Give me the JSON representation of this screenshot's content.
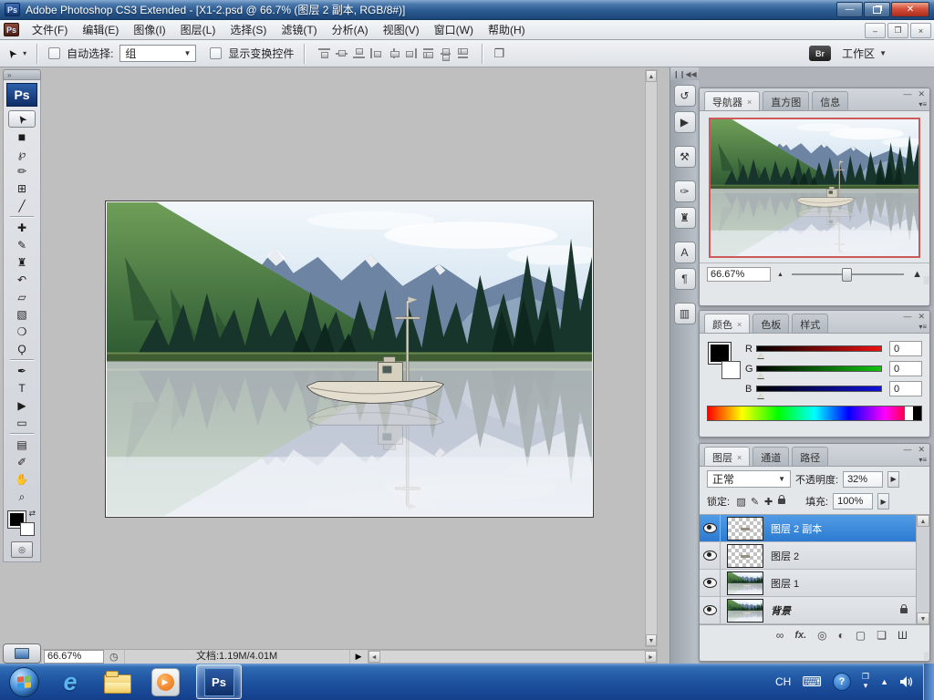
{
  "app": {
    "icon_text": "Ps",
    "bridge_badge": "Br"
  },
  "window": {
    "title": "Adobe Photoshop CS3 Extended - [X1-2.psd @ 66.7% (图层 2 副本, RGB/8#)]",
    "minimize_glyph": "—",
    "close_glyph": "✕"
  },
  "menu_bar": {
    "items": [
      {
        "key": "file",
        "label": "文件(F)"
      },
      {
        "key": "edit",
        "label": "编辑(E)"
      },
      {
        "key": "image",
        "label": "图像(I)"
      },
      {
        "key": "layer",
        "label": "图层(L)"
      },
      {
        "key": "select",
        "label": "选择(S)"
      },
      {
        "key": "filter",
        "label": "滤镜(T)"
      },
      {
        "key": "analysis",
        "label": "分析(A)"
      },
      {
        "key": "view",
        "label": "视图(V)"
      },
      {
        "key": "window",
        "label": "窗口(W)"
      },
      {
        "key": "help",
        "label": "帮助(H)"
      }
    ]
  },
  "options_bar": {
    "move_tool_glyph": "➤",
    "auto_select_label": "自动选择:",
    "auto_select_value": "组",
    "show_transform_label": "显示变换控件",
    "workspace_label": "工作区",
    "align_icons": [
      {
        "name": "align-top-edges-icon",
        "cls": "at"
      },
      {
        "name": "align-vertical-centers-icon",
        "cls": "am"
      },
      {
        "name": "align-bottom-edges-icon",
        "cls": "ab"
      },
      {
        "name": "align-left-edges-icon",
        "cls": "al"
      },
      {
        "name": "align-horizontal-centers-icon",
        "cls": "ac"
      },
      {
        "name": "align-right-edges-icon",
        "cls": "ar"
      },
      {
        "name": "distribute-top-edges-icon",
        "cls": "dt"
      },
      {
        "name": "distribute-vertical-centers-icon",
        "cls": "dc"
      },
      {
        "name": "distribute-bottom-edges-icon",
        "cls": "db"
      }
    ],
    "auto_align_glyph": "❒"
  },
  "toolbox": {
    "expand_glyph": "»",
    "tools": [
      {
        "name": "move-tool",
        "glyph": "➤",
        "selected": true
      },
      {
        "name": "rectangular-marquee-tool",
        "glyph": "■"
      },
      {
        "name": "lasso-tool",
        "glyph": "℘"
      },
      {
        "name": "quick-selection-tool",
        "glyph": "✏"
      },
      {
        "name": "crop-tool",
        "glyph": "⊞"
      },
      {
        "name": "slice-tool",
        "glyph": "╱"
      },
      {
        "name": "spot-healing-brush-tool",
        "glyph": "✚",
        "sep": true
      },
      {
        "name": "brush-tool",
        "glyph": "✎"
      },
      {
        "name": "clone-stamp-tool",
        "glyph": "♜"
      },
      {
        "name": "history-brush-tool",
        "glyph": "↶"
      },
      {
        "name": "eraser-tool",
        "glyph": "▱"
      },
      {
        "name": "gradient-tool",
        "glyph": "▧"
      },
      {
        "name": "blur-tool",
        "glyph": "❍"
      },
      {
        "name": "dodge-tool",
        "glyph": "Ϙ"
      },
      {
        "name": "pen-tool",
        "glyph": "✒",
        "sep": true
      },
      {
        "name": "type-tool",
        "glyph": "T"
      },
      {
        "name": "path-selection-tool",
        "glyph": "▶"
      },
      {
        "name": "shape-tool",
        "glyph": "▭"
      },
      {
        "name": "notes-tool",
        "glyph": "▤",
        "sep": true
      },
      {
        "name": "eyedropper-tool",
        "glyph": "✐"
      },
      {
        "name": "hand-tool",
        "glyph": "✋"
      },
      {
        "name": "zoom-tool",
        "glyph": "⌕"
      }
    ]
  },
  "dock": {
    "icons": [
      {
        "name": "history-panel-icon",
        "glyph": "↺"
      },
      {
        "name": "actions-panel-icon",
        "glyph": "▶"
      },
      {
        "name": "tool-presets-panel-icon",
        "glyph": "⚒",
        "gap": true
      },
      {
        "name": "brushes-panel-icon",
        "glyph": "✑",
        "gap": true
      },
      {
        "name": "clone-source-panel-icon",
        "glyph": "♜"
      },
      {
        "name": "character-panel-icon",
        "glyph": "A",
        "gap": true
      },
      {
        "name": "paragraph-panel-icon",
        "glyph": "¶"
      },
      {
        "name": "layer-comps-panel-icon",
        "glyph": "▥",
        "gap": true
      }
    ]
  },
  "panels": {
    "navigator": {
      "tabs": [
        {
          "key": "navigator",
          "label": "导航器",
          "active": true
        },
        {
          "key": "histogram",
          "label": "直方图"
        },
        {
          "key": "info",
          "label": "信息"
        }
      ],
      "zoom_value": "66.67%"
    },
    "color": {
      "tabs": [
        {
          "key": "color",
          "label": "颜色",
          "active": true
        },
        {
          "key": "swatches",
          "label": "色板"
        },
        {
          "key": "styles",
          "label": "样式"
        }
      ],
      "channels": [
        {
          "label": "R",
          "value": "0",
          "from": "#000000",
          "to": "#ee1111"
        },
        {
          "label": "G",
          "value": "0",
          "from": "#000000",
          "to": "#11c411"
        },
        {
          "label": "B",
          "value": "0",
          "from": "#000000",
          "to": "#1111dd"
        }
      ]
    },
    "layers": {
      "tabs": [
        {
          "key": "layers",
          "label": "图层",
          "active": true
        },
        {
          "key": "channels",
          "label": "通道"
        },
        {
          "key": "paths",
          "label": "路径"
        }
      ],
      "blend_mode": "正常",
      "opacity_label": "不透明度:",
      "opacity_value": "32%",
      "lock_label": "锁定:",
      "lock_icons": [
        {
          "name": "lock-transparent-pixels-icon",
          "glyph": "▨"
        },
        {
          "name": "lock-image-pixels-icon",
          "glyph": "✎"
        },
        {
          "name": "lock-position-icon",
          "glyph": "✚"
        },
        {
          "name": "lock-all-icon",
          "glyph": "css-lock"
        }
      ],
      "fill_label": "填充:",
      "fill_value": "100%",
      "items": [
        {
          "name": "图层 2 副本",
          "thumb": "checker",
          "selected": true
        },
        {
          "name": "图层 2",
          "thumb": "checker"
        },
        {
          "name": "图层 1",
          "thumb": "image"
        },
        {
          "name": "背景",
          "thumb": "image",
          "locked": true,
          "italic": true
        }
      ],
      "actions": [
        {
          "name": "link-layers-icon",
          "glyph": "∞"
        },
        {
          "name": "layer-style-icon",
          "glyph": "fx."
        },
        {
          "name": "add-layer-mask-icon",
          "glyph": "◎"
        },
        {
          "name": "adjustment-layer-icon",
          "glyph": "◐"
        },
        {
          "name": "new-group-icon",
          "glyph": "▢"
        },
        {
          "name": "new-layer-icon",
          "glyph": "❏"
        },
        {
          "name": "delete-layer-icon",
          "glyph": "Ш"
        }
      ]
    }
  },
  "status_bar": {
    "zoom": "66.67%",
    "doc_label": "文档:1.19M/4.01M"
  },
  "taskbar": {
    "tray_language": "CH"
  }
}
